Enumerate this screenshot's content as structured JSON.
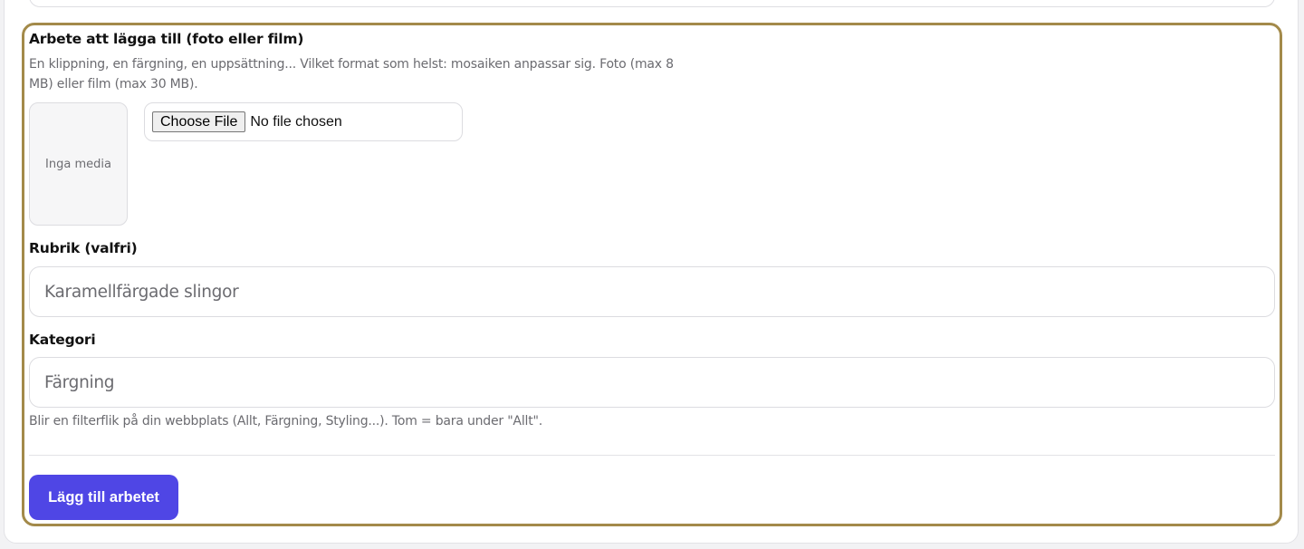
{
  "upload": {
    "label": "Arbete att lägga till (foto eller film)",
    "help_line1": "En klippning, en färgning, en uppsättning... Vilket format som helst: mosaiken anpassar sig. Foto (max 8",
    "help_line2": "MB) eller film (max 30 MB).",
    "preview_empty": "Inga media",
    "choose_file_label": "Choose File",
    "file_status": "No file chosen"
  },
  "title_field": {
    "label": "Rubrik (valfri)",
    "placeholder": "Karamellfärgade slingor"
  },
  "category_field": {
    "label": "Kategori",
    "placeholder": "Färgning",
    "help": "Blir en filterflik på din webbplats (Allt, Färgning, Styling...). Tom = bara under \"Allt\"."
  },
  "actions": {
    "submit_label": "Lägg till arbetet"
  },
  "colors": {
    "accent": "#4f46e5",
    "highlight_border": "#a38a4a"
  }
}
